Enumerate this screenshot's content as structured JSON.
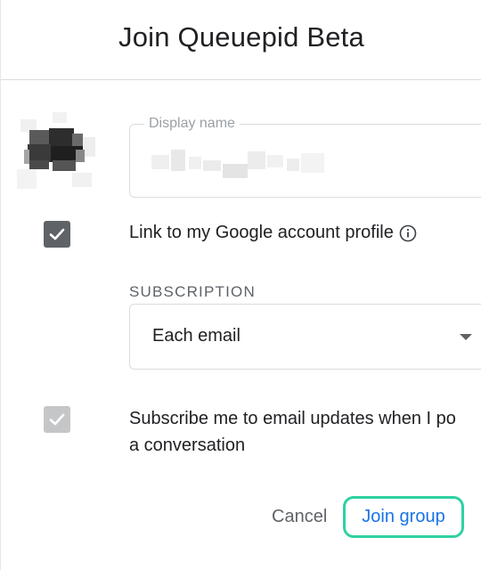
{
  "dialog": {
    "title": "Join Queuepid Beta"
  },
  "profile": {
    "display_name_label": "Display name",
    "link_profile_label": "Link to my Google account profile",
    "link_profile_checked": true
  },
  "subscription": {
    "section_label": "SUBSCRIPTION",
    "selected_option": "Each email",
    "subscribe_label_line1": "Subscribe me to email updates when I po",
    "subscribe_label_line2": "a conversation",
    "subscribe_checked": true,
    "subscribe_disabled": true
  },
  "actions": {
    "cancel_label": "Cancel",
    "join_label": "Join group"
  },
  "colors": {
    "accent": "#1a73e8",
    "focus_ring": "#2ed1a2",
    "checkbox_active": "#5f6368",
    "checkbox_disabled": "#c5c6c8"
  }
}
